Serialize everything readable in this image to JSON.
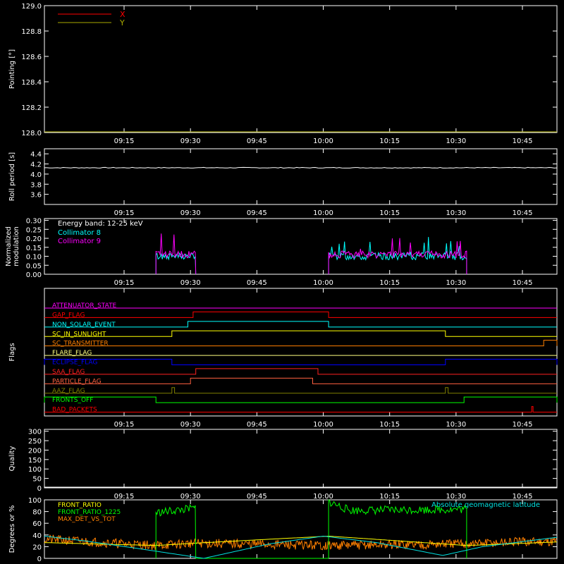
{
  "time_ticks": [
    "09:15",
    "09:30",
    "09:45",
    "10:00",
    "10:15",
    "10:30",
    "10:45"
  ],
  "chart_data": [
    {
      "type": "line",
      "ylabel": "Pointing [°]",
      "ylim": [
        128.0,
        129.0
      ],
      "yticks": [
        "128.0",
        "128.2",
        "128.4",
        "128.6",
        "128.8",
        "129.0"
      ],
      "legend": "top-left",
      "series": [
        {
          "name": "X",
          "color": "#ff0000",
          "values": []
        },
        {
          "name": "Y",
          "color": "#aaaa00",
          "values": []
        }
      ]
    },
    {
      "type": "line",
      "ylabel": "Roll period [s]",
      "ylim": [
        3.4,
        4.5
      ],
      "yticks": [
        "3.6",
        "3.8",
        "4.0",
        "4.2",
        "4.4"
      ],
      "series": [
        {
          "color": "#ffffff",
          "values": [
            [
              9.0,
              4.13
            ],
            [
              9.5,
              4.12
            ],
            [
              10.0,
              4.13
            ],
            [
              10.5,
              4.12
            ],
            [
              10.85,
              4.12
            ]
          ]
        }
      ]
    },
    {
      "type": "line",
      "ylabel": "Normalized modulation",
      "ylim": [
        0.0,
        0.31
      ],
      "yticks": [
        "0.00",
        "0.05",
        "0.10",
        "0.15",
        "0.20",
        "0.25",
        "0.30"
      ],
      "legend_title": "Energy band: 12-25 keV",
      "series": [
        {
          "name": "Collimator 8",
          "color": "#00ffff",
          "segments": [
            [
              9.37,
              9.52,
              0.1
            ],
            [
              10.02,
              10.54,
              0.1
            ]
          ]
        },
        {
          "name": "Collimator 9",
          "color": "#ff00ff",
          "segments": [
            [
              9.37,
              9.52,
              0.11
            ],
            [
              10.02,
              10.54,
              0.11
            ]
          ]
        }
      ]
    },
    {
      "type": "line",
      "ylabel": "Flags",
      "flags": [
        {
          "name": "ATTENUATOR_STATE",
          "color": "#ff00ff",
          "on": []
        },
        {
          "name": "GAP_FLAG",
          "color": "#ff0000",
          "on": [
            [
              9.51,
              10.02
            ]
          ]
        },
        {
          "name": "NON_SOLAR_EVENT",
          "color": "#00ffff",
          "on": [
            [
              9.49,
              10.02
            ]
          ]
        },
        {
          "name": "SC_IN_SUNLIGHT",
          "color": "#ffff00",
          "on": [
            [
              9.43,
              10.46
            ]
          ]
        },
        {
          "name": "SC_TRANSMITTER",
          "color": "#ff8000",
          "on": [
            [
              10.83,
              10.88
            ]
          ]
        },
        {
          "name": "FLARE_FLAG",
          "color": "#ffff80",
          "on": []
        },
        {
          "name": "ECLIPSE_FLAG",
          "color": "#0000ff",
          "on": [
            [
              8.95,
              9.43
            ],
            [
              10.46,
              10.88
            ]
          ]
        },
        {
          "name": "SAA_FLAG",
          "color": "#ff2020",
          "on": [
            [
              9.52,
              9.98
            ]
          ]
        },
        {
          "name": "PARTICLE_FLAG",
          "color": "#ff6040",
          "on": [
            [
              9.5,
              9.96
            ]
          ]
        },
        {
          "name": "AAZ_FLAG",
          "color": "#808000",
          "on": [
            [
              9.43,
              9.44
            ],
            [
              10.46,
              10.47
            ]
          ]
        },
        {
          "name": "FRONTS_OFF",
          "color": "#00ff00",
          "on": [
            [
              8.95,
              9.37
            ],
            [
              10.53,
              10.88
            ]
          ]
        },
        {
          "name": "BAD_PACKETS",
          "color": "#ff0000",
          "on": [
            [
              10.785,
              10.79
            ]
          ]
        }
      ]
    },
    {
      "type": "line",
      "ylabel": "Quality",
      "ylim": [
        0,
        310
      ],
      "yticks": [
        "0",
        "50",
        "100",
        "150",
        "200",
        "250",
        "300"
      ],
      "series": []
    },
    {
      "type": "line",
      "ylabel": "Degrees or %",
      "ylim": [
        0,
        100
      ],
      "yticks": [
        "0",
        "20",
        "40",
        "60",
        "80",
        "100"
      ],
      "series": [
        {
          "name": "FRONT_RATIO",
          "color": "#ffff00",
          "values": [
            [
              8.95,
              27
            ],
            [
              9.37,
              22
            ],
            [
              9.52,
              26
            ],
            [
              10.02,
              38
            ],
            [
              10.54,
              22
            ],
            [
              10.88,
              28
            ]
          ]
        },
        {
          "name": "FRONT_RATIO_1225",
          "color": "#00ff00",
          "values": [
            [
              9.37,
              78
            ],
            [
              9.52,
              86
            ],
            [
              10.02,
              97
            ],
            [
              10.1,
              82
            ],
            [
              10.54,
              84
            ]
          ]
        },
        {
          "name": "MAX_DET_VS_TOT",
          "color": "#ff8000",
          "values": [
            [
              8.95,
              33
            ],
            [
              9.37,
              22
            ],
            [
              9.52,
              26
            ],
            [
              10.02,
              22
            ],
            [
              10.54,
              25
            ],
            [
              10.88,
              30
            ]
          ]
        },
        {
          "name": "Absolute geomagnetic latitude",
          "color": "#00e0e0",
          "values": [
            [
              8.95,
              38
            ],
            [
              9.1,
              30
            ],
            [
              9.3,
              17
            ],
            [
              9.55,
              0
            ],
            [
              9.8,
              25
            ],
            [
              10.0,
              38
            ],
            [
              10.2,
              27
            ],
            [
              10.45,
              5
            ],
            [
              10.6,
              20
            ],
            [
              10.88,
              36
            ]
          ]
        }
      ]
    }
  ]
}
